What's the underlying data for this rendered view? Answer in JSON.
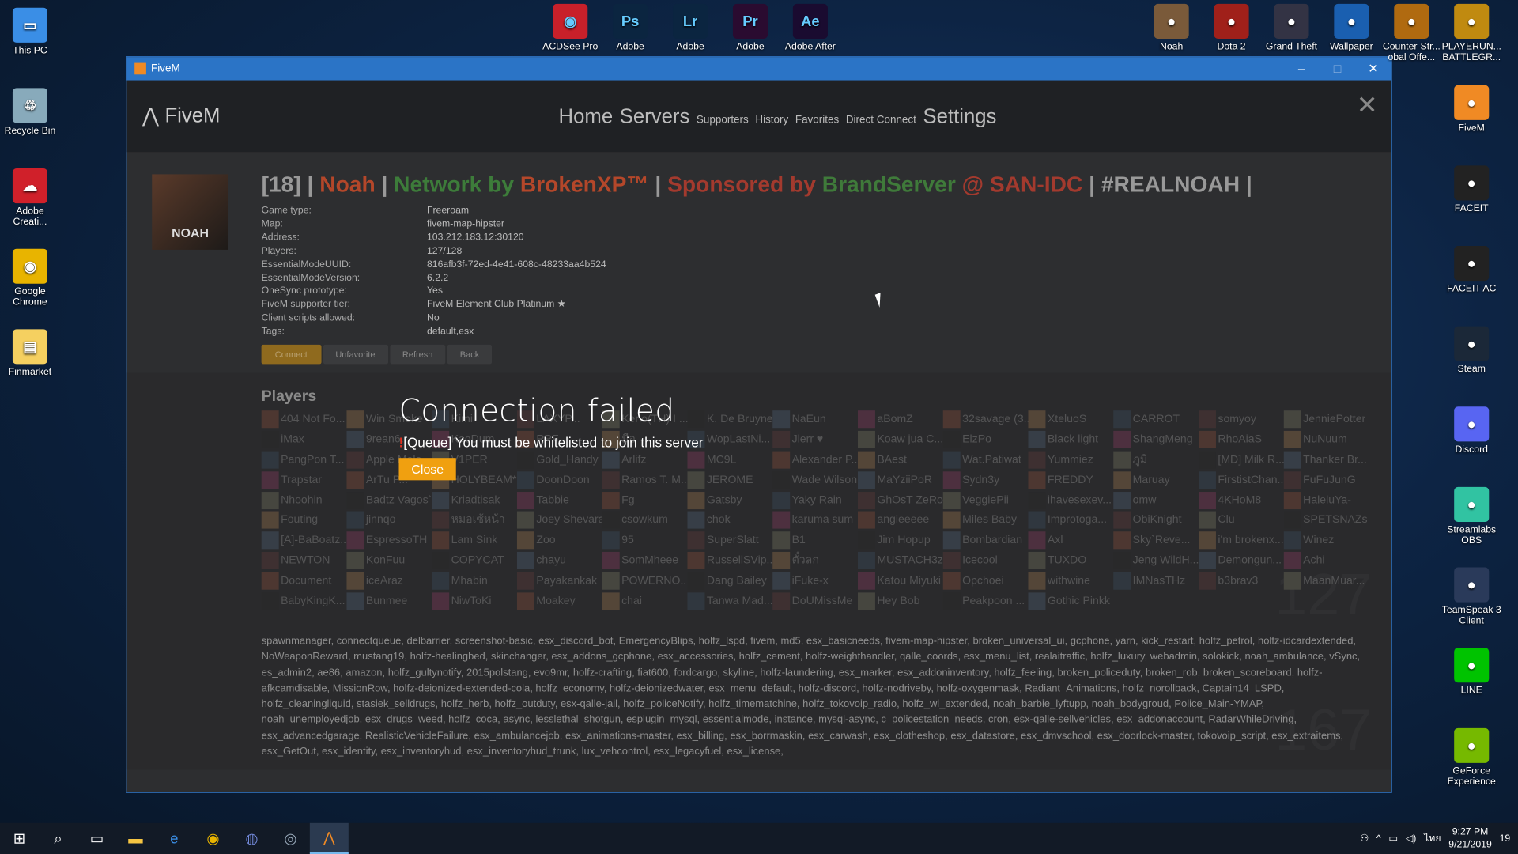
{
  "desktop": {
    "left_icons": [
      "This PC",
      "Recycle Bin",
      "Adobe Creati...",
      "Google Chrome",
      "Finmarket"
    ],
    "top_icons": [
      "ACDSee Pro",
      "Adobe",
      "Adobe",
      "Adobe",
      "Adobe After"
    ],
    "top_glyphs": [
      "◉",
      "Ps",
      "Lr",
      "Pr",
      "Ae"
    ],
    "top_right_icons": [
      "Noah",
      "Dota 2",
      "Grand Theft",
      "Wallpaper",
      "Counter-Str... obal Offe...",
      "PLAYERUN... BATTLEGR..."
    ],
    "right_icons": [
      "FiveM",
      "FACEIT",
      "FACEIT AC",
      "Steam",
      "Discord",
      "Streamlabs OBS",
      "TeamSpeak 3 Client",
      "LINE",
      "GeForce Experience"
    ]
  },
  "window": {
    "title": "FiveM",
    "minimize": "–",
    "maximize": "□",
    "close": "✕"
  },
  "header": {
    "brand": "FiveM",
    "nav": {
      "home": "Home",
      "servers": "Servers",
      "supporters": "Supporters",
      "history": "History",
      "favorites": "Favorites",
      "direct": "Direct Connect",
      "settings": "Settings"
    },
    "close": "✕"
  },
  "server": {
    "avatar_text": "NOAH",
    "title": {
      "p1": "[18] | ",
      "p2": "Noah",
      "p3": " | ",
      "p4": "Network by ",
      "p5": "BrokenXP™",
      "p6": " | ",
      "p7": "Sponsored by ",
      "p8": "BrandServer",
      "p9": " @ SAN-IDC",
      "p10": " | #REALNOAH |"
    },
    "info": [
      {
        "k": "Game type:",
        "v": "Freeroam"
      },
      {
        "k": "Map:",
        "v": "fivem-map-hipster"
      },
      {
        "k": "Address:",
        "v": "103.212.183.12:30120"
      },
      {
        "k": "Players:",
        "v": "127/128"
      },
      {
        "k": "EssentialModeUUID:",
        "v": "816afb3f-72ed-4e41-608c-48233aa4b524"
      },
      {
        "k": "EssentialModeVersion:",
        "v": "6.2.2"
      },
      {
        "k": "OneSync prototype:",
        "v": "Yes"
      },
      {
        "k": "FiveM supporter tier:",
        "v": "FiveM Element Club Platinum ★"
      },
      {
        "k": "Client scripts allowed:",
        "v": "No"
      },
      {
        "k": "Tags:",
        "v": "default,esx"
      }
    ],
    "buttons": {
      "connect": "Connect",
      "unfavorite": "Unfavorite",
      "refresh": "Refresh",
      "back": "Back"
    },
    "players_heading": "Players",
    "players": [
      "404 Not Fo...",
      "Win Smoke",
      "Kimi",
      "LAXYP...",
      "Keno(TH) I ...",
      "K. De Bruyne",
      "NaEun",
      "aBomZ",
      "32savage (3...",
      "XteluoS",
      "CARROT",
      "somyoy",
      "JenniePotter",
      "iMax",
      "9rean6...",
      "KaoDum",
      "RPF",
      "มือ",
      "WopLastNi...",
      "Jlerr ♥",
      "Koaw jua C...",
      "ElzPo",
      "Black light",
      "ShangMeng",
      "RhoAiaS",
      "NuNuum",
      "PangPon T...",
      "Apple Mela",
      "V1PER",
      "Gold_Handy",
      "Arlifz",
      "MC9L",
      "Alexander P...",
      "BAest",
      "Wat.Patiwat",
      "Yummiez",
      "ภูมิ",
      "[MD] Milk R...",
      "Thanker Br...",
      "Trapstar",
      "ArTu P...",
      "HOLYBEAM*",
      "DoonDoon",
      "Ramos T. M...",
      "JEROME",
      "Wade Wilson",
      "MaYziiPoR",
      "Sydn3y",
      "FREDDY",
      "Maruay",
      "FirstistChan...",
      "FuFuJunG",
      "Nhoohin",
      "Badtz Vagos`",
      "Kriadtisak",
      "Tabbie",
      "Fg",
      "Gatsby",
      "Yaky Rain",
      "GhOsT ZeRo",
      "VeggiePii",
      "ihavesexev...",
      "omw",
      "4KHoM8",
      "HaleluYa-",
      "Fouting",
      "jinnqo",
      "หมอเซ้หน้า",
      "Joey Shevara",
      "csowkum",
      "chok",
      "karuma sum",
      "angieeeee",
      "Miles Baby",
      "Improtoga...",
      "ObiKnight",
      "Clu",
      "SPETSNAZs",
      "[A]-BaBoatz...",
      "EspressoTH",
      "Lam Sink",
      "Zoo",
      "95",
      "SuperSlatt",
      "B1",
      "Jim Hopup",
      "Bombardian",
      "Axl",
      "Sky`Reve...",
      "i'm brokenx...",
      "Winez",
      "NEWTON",
      "KonFuu",
      "COPYCAT",
      "chayu",
      "SomMheee",
      "RussellSVip...",
      "ตั๋วลก",
      "MUSTACH3z",
      "Icecool",
      "TUXDO",
      "Jeng WildH...",
      "Demongun...",
      "Achi",
      "Document",
      "iceAraz",
      "Mhabin",
      "Payakankak",
      "POWERNO...",
      "Dang Bailey",
      "iFuke-x",
      "Katou Miyuki",
      "Opchoei",
      "withwine",
      "IMNasTHz",
      "b3brav3",
      "MaanMuar...",
      "BabyKingK...",
      "Bunmee",
      "NiwToKi",
      "Moakey",
      "chai",
      "Tanwa Mad...",
      "DoUMissMe",
      "Hey Bob",
      "Peakpoon ...",
      "Gothic Pinkk"
    ],
    "player_count_watermark": "127",
    "resource_count_watermark": "167",
    "resources": "spawnmanager, connectqueue, delbarrier, screenshot-basic, esx_discord_bot, EmergencyBlips, holfz_lspd, fivem, md5, esx_basicneeds, fivem-map-hipster, broken_universal_ui, gcphone, yarn, kick_restart, holfz_petrol, holfz-idcardextended, NoWeaponReward, mustang19, holfz-healingbed, skinchanger, esx_addons_gcphone, esx_accessories, holfz_cement, holfz-weighthandler, qalle_coords, esx_menu_list, realaitraffic, holfz_luxury, webadmin, solokick, noah_ambulance, vSync, es_admin2, ae86, amazon, holfz_gultynotify, 2015polstang, evo9mr, holfz-crafting, fiat600, fordcargo, skyline, holfz-laundering, esx_marker, esx_addoninventory, holfz_feeling, broken_policeduty, broken_rob, broken_scoreboard, holfz-afkcamdisable, MissionRow, holfz-deionized-extended-cola, holfz_economy, holfz-deionizedwater, esx_menu_default, holfz-discord, holfz-nodriveby, holfz-oxygenmask, Radiant_Animations, holfz_norollback, Captain14_LSPD, holfz_cleaningliquid, stasiek_selldrugs, holfz_herb, holfz_outduty, esx-qalle-jail, holfz_policeNotify, holfz_timematchine, holfz_tokovoip_radio, holfz_wl_extended, noah_barbie_lyftupp, noah_bodygroud, Police_Main-YMAP, noah_unemployedjob, esx_drugs_weed, holfz_coca, async, lesslethal_shotgun, esplugin_mysql, essentialmode, instance, mysql-async, c_policestation_needs, cron, esx-qalle-sellvehicles, esx_addonaccount, RadarWhileDriving, esx_advancedgarage, RealisticVehicleFailure, esx_ambulancejob, esx_animations-master, esx_billing, esx_borrmaskin, esx_carwash, esx_clotheshop, esx_datastore, esx_dmvschool, esx_doorlock-master, tokovoip_script, esx_extraitems, esx_GetOut, esx_identity, esx_inventoryhud, esx_inventoryhud_trunk, lux_vehcontrol, esx_legacyfuel, esx_license,"
  },
  "dialog": {
    "title": "Connection failed",
    "icon": "!",
    "message": "[Queue] You must be whitelisted to join this server",
    "close": "Close"
  },
  "taskbar": {
    "time": "9:27 PM",
    "date": "9/21/2019",
    "lang": "ไทย",
    "notifications": "19"
  },
  "colors": {
    "accent": "#f0a010",
    "titlebar": "#2b74c6",
    "noah": "#b4472a",
    "network": "#3d7c3a"
  }
}
